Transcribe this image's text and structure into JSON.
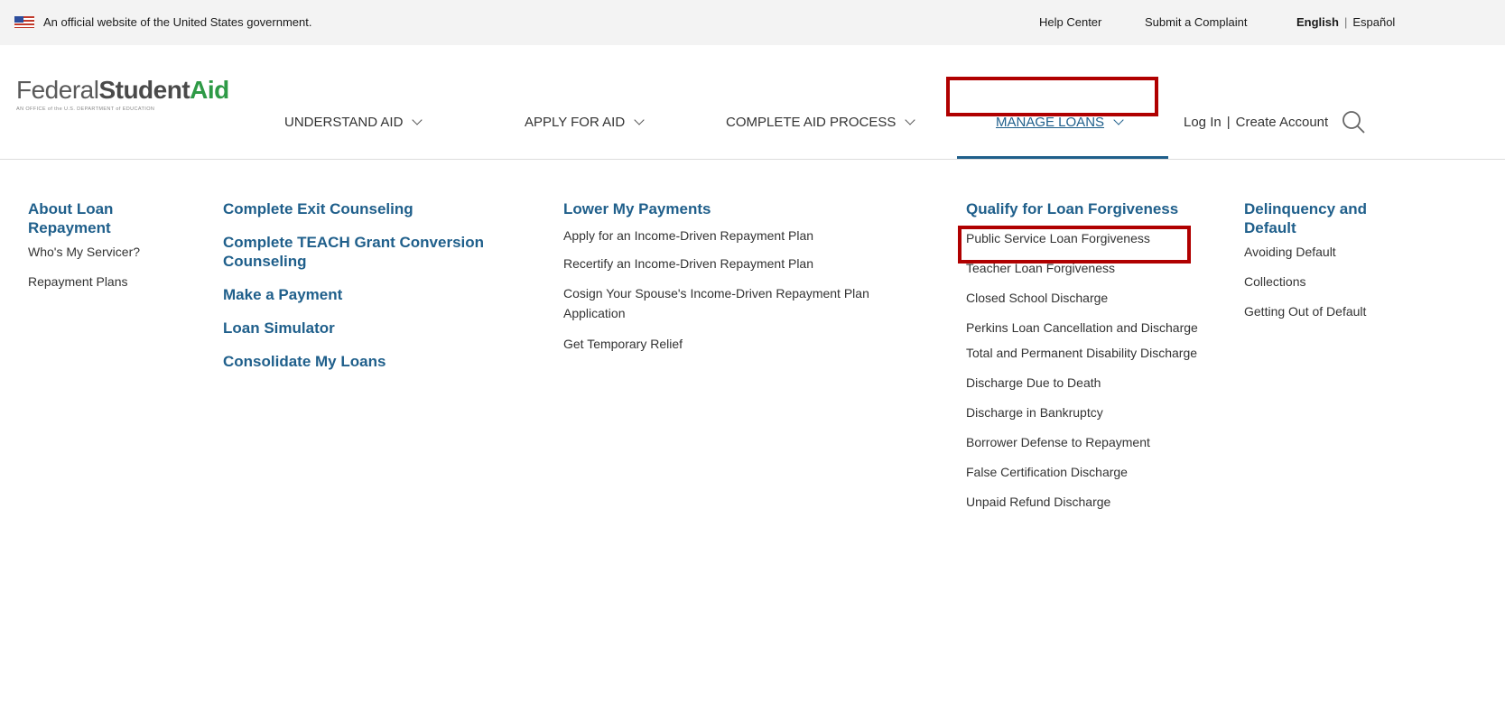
{
  "gov_banner": {
    "text": "An official website of the United States government.",
    "help_center": "Help Center",
    "submit_complaint": "Submit a Complaint",
    "lang_english": "English",
    "lang_separator": "|",
    "lang_espanol": "Español"
  },
  "logo": {
    "federal": "Federal",
    "student": "Student",
    "aid": "Aid",
    "subtitle": "AN OFFICE of the U.S. DEPARTMENT of EDUCATION"
  },
  "nav": {
    "understand_aid": "UNDERSTAND AID",
    "apply_for_aid": "APPLY FOR AID",
    "complete_aid_process": "COMPLETE AID PROCESS",
    "manage_loans": "MANAGE LOANS"
  },
  "account": {
    "log_in": "Log In",
    "separator": "|",
    "create_account": "Create Account"
  },
  "menu": {
    "col1": {
      "heading": "About Loan Repayment",
      "links": [
        "Who's My Servicer?",
        "Repayment Plans"
      ]
    },
    "col2": {
      "links": [
        "Complete Exit Counseling",
        "Complete TEACH Grant Conversion Counseling",
        "Make a Payment",
        "Loan Simulator",
        "Consolidate My Loans"
      ]
    },
    "col3": {
      "heading": "Lower My Payments",
      "links": [
        "Apply for an Income-Driven Repayment Plan",
        "Recertify an Income-Driven Repayment Plan",
        "Cosign Your Spouse's Income-Driven Repayment Plan Application",
        "Get Temporary Relief"
      ]
    },
    "col4": {
      "heading": "Qualify for Loan Forgiveness",
      "links": [
        "Public Service Loan Forgiveness",
        "Teacher Loan Forgiveness",
        "Closed School Discharge",
        "Perkins Loan Cancellation and Discharge",
        "Total and Permanent Disability Discharge",
        "Discharge Due to Death",
        "Discharge in Bankruptcy",
        "Borrower Defense to Repayment",
        "False Certification Discharge",
        "Unpaid Refund Discharge"
      ]
    },
    "col5": {
      "heading": "Delinquency and Default",
      "links": [
        "Avoiding Default",
        "Collections",
        "Getting Out of Default"
      ]
    }
  },
  "colors": {
    "link_blue": "#1f5f8b",
    "brand_green": "#2e9a46",
    "highlight_red": "#b00000"
  }
}
